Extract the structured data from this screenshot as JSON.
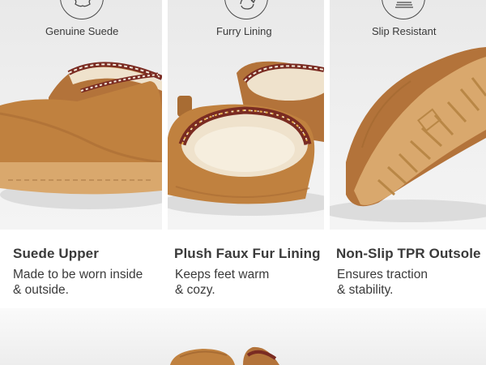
{
  "features": [
    {
      "icon": "suede-hide-icon",
      "label": "Genuine Suede",
      "title": "Suede Upper",
      "desc_lines": [
        "Made to be worn inside",
        "& outside."
      ]
    },
    {
      "icon": "fur-swirl-icon",
      "label": "Furry Lining",
      "title": "Plush Faux Fur Lining",
      "desc_lines": [
        "Keeps feet warm",
        "& cozy."
      ]
    },
    {
      "icon": "grip-lines-icon",
      "label": "Slip Resistant",
      "title": "Non-Slip TPR Outsole",
      "desc_lines": [
        "Ensures traction",
        "& stability."
      ]
    }
  ],
  "colors": {
    "suede": "#c0813f",
    "suede_dark": "#8a5726",
    "sole": "#d9a86d",
    "fur": "#efe2cc",
    "braid_red": "#7a2b22",
    "text": "#3a3a3a"
  }
}
